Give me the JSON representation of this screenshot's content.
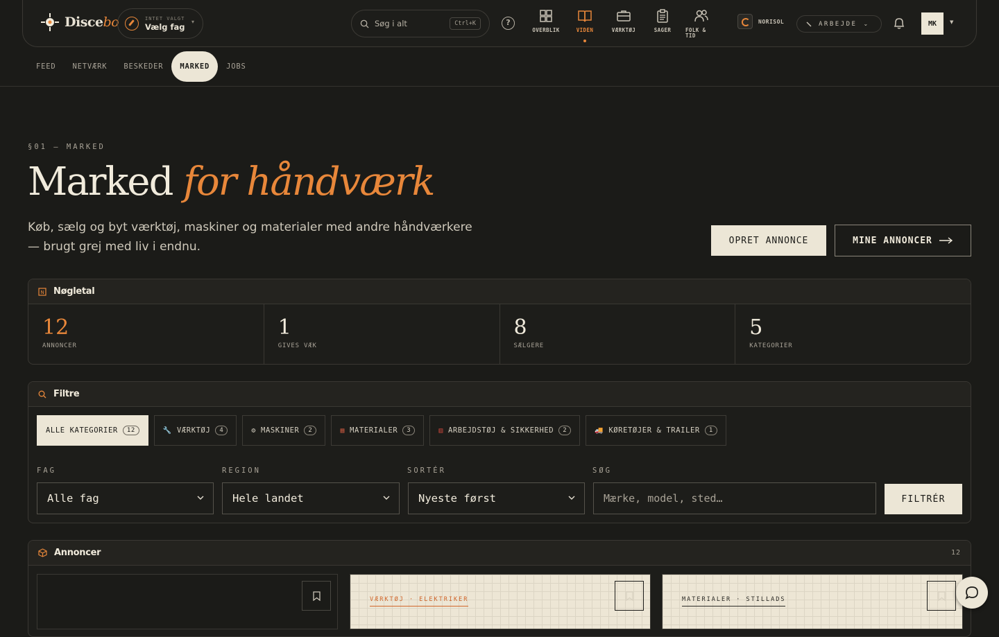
{
  "brand": {
    "name": "Disce",
    "name_italic": "bo"
  },
  "fag_selector": {
    "label": "INTET VALGT",
    "value": "Vælg fag"
  },
  "search": {
    "placeholder": "Søg i alt",
    "shortcut": "Ctrl+K"
  },
  "nav": [
    {
      "label": "OVERBLIK",
      "icon": "grid-icon"
    },
    {
      "label": "VIDEN",
      "icon": "book-icon",
      "active": true
    },
    {
      "label": "VÆRKTØJ",
      "icon": "briefcase-icon"
    },
    {
      "label": "SAGER",
      "icon": "clipboard-icon"
    },
    {
      "label": "FOLK & TID",
      "icon": "people-icon"
    }
  ],
  "org": {
    "name": "NORISOL"
  },
  "status": {
    "label": "ARBEJDE"
  },
  "user": {
    "initials": "MK"
  },
  "subnav": [
    "FEED",
    "NETVÆRK",
    "BESKEDER",
    "MARKED",
    "JOBS"
  ],
  "hero": {
    "kicker": "§01 — MARKED",
    "title": "Marked",
    "title_italic": "for håndværk",
    "lead": "Køb, sælg og byt værktøj, maskiner og materialer med andre håndværkere — brugt grej med liv i endnu.",
    "btn_create": "OPRET ANNONCE",
    "btn_mine": "MINE ANNONCER"
  },
  "stats": {
    "title": "Nøgletal",
    "items": [
      {
        "value": "12",
        "label": "ANNONCER"
      },
      {
        "value": "1",
        "label": "GIVES VÆK"
      },
      {
        "value": "8",
        "label": "SÆLGERE"
      },
      {
        "value": "5",
        "label": "KATEGORIER"
      }
    ]
  },
  "filters": {
    "title": "Filtre",
    "chips": [
      {
        "label": "ALLE KATEGORIER",
        "count": "12",
        "icon": ""
      },
      {
        "label": "VÆRKTØJ",
        "count": "4",
        "icon": "wrench-icon"
      },
      {
        "label": "MASKINER",
        "count": "2",
        "icon": "gear-icon"
      },
      {
        "label": "MATERIALER",
        "count": "3",
        "icon": "brick-icon"
      },
      {
        "label": "ARBEJDSTØJ & SIKKERHED",
        "count": "2",
        "icon": "vest-icon"
      },
      {
        "label": "KØRETØJER & TRAILER",
        "count": "1",
        "icon": "truck-icon"
      }
    ],
    "fag_label": "FAG",
    "fag_value": "Alle fag",
    "region_label": "REGION",
    "region_value": "Hele landet",
    "sort_label": "SORTÉR",
    "sort_value": "Nyeste først",
    "search_label": "SØG",
    "search_placeholder": "Mærke, model, sted…",
    "submit": "FILTRÉR"
  },
  "listings": {
    "title": "Annoncer",
    "count": "12",
    "cards": [
      {
        "tag": ""
      },
      {
        "tag": "VÆRKTØJ · ELEKTRIKER"
      },
      {
        "tag": "MATERIALER · STILLADS"
      }
    ]
  },
  "colors": {
    "accent": "#e8873a",
    "bg": "#1b1b18",
    "cream": "#ece6d6"
  }
}
